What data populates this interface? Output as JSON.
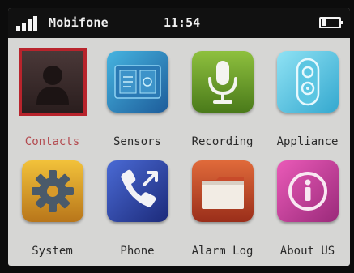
{
  "status_bar": {
    "carrier": "Mobifone",
    "time": "11:54",
    "signal_level": 4,
    "battery_level": 0.3,
    "icons": [
      "signal-icon",
      "battery-icon"
    ]
  },
  "apps": [
    {
      "label": "Contacts",
      "icon": "contacts-icon",
      "color": "#3a2a2a",
      "selected": true
    },
    {
      "label": "Sensors",
      "icon": "sensors-icon",
      "color": "#2f8fc4",
      "selected": false
    },
    {
      "label": "Recording",
      "icon": "microphone-icon",
      "color": "#6a9a2a",
      "selected": false
    },
    {
      "label": "Appliance",
      "icon": "remote-icon",
      "color": "#5cc6e2",
      "selected": false
    },
    {
      "label": "System",
      "icon": "gear-icon",
      "color": "#e0a21a",
      "selected": false
    },
    {
      "label": "Phone",
      "icon": "phone-icon",
      "color": "#2a3f9c",
      "selected": false
    },
    {
      "label": "Alarm Log",
      "icon": "folder-icon",
      "color": "#c84a2a",
      "selected": false
    },
    {
      "label": "About US",
      "icon": "info-icon",
      "color": "#d43a9a",
      "selected": false
    }
  ],
  "colors": {
    "selection": "#b8242c",
    "screen_background": "#d6d6d4",
    "status_bar_background": "#111111"
  }
}
